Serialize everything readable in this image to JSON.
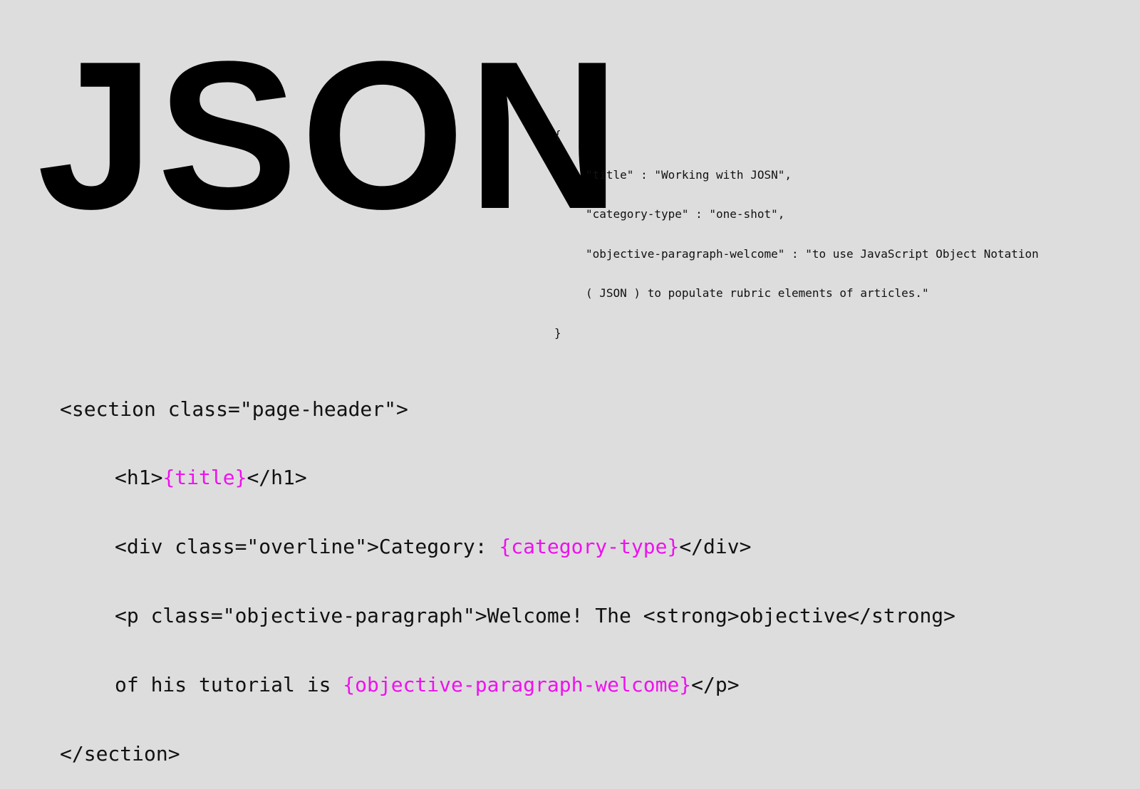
{
  "header": {
    "big_title": "JSON"
  },
  "json_snippet": {
    "open_brace": "{",
    "lines": [
      "\"title\" : \"Working with JOSN\",",
      "\"category-type\" : \"one-shot\",",
      "\"objective-paragraph-welcome\" : \"to use JavaScript Object Notation",
      "( JSON ) to populate rubric elements of articles.\""
    ],
    "close_brace": "}"
  },
  "html_snippet": {
    "line1": "<section class=\"page-header\">",
    "line2_pre": "<h1>",
    "line2_ph": "{title}",
    "line2_post": "</h1>",
    "line3_pre": "<div class=\"overline\">Category: ",
    "line3_ph": "{category-type}",
    "line3_post": "</div>",
    "line4": "<p class=\"objective-paragraph\">Welcome! The <strong>objective</strong>",
    "line5_pre": "of his tutorial is ",
    "line5_ph": "{objective-paragraph-welcome}",
    "line5_post": "</p>",
    "line6": "</section>"
  },
  "colors": {
    "background": "#dddddd",
    "text": "#000000",
    "placeholder": "#ee11ee"
  }
}
